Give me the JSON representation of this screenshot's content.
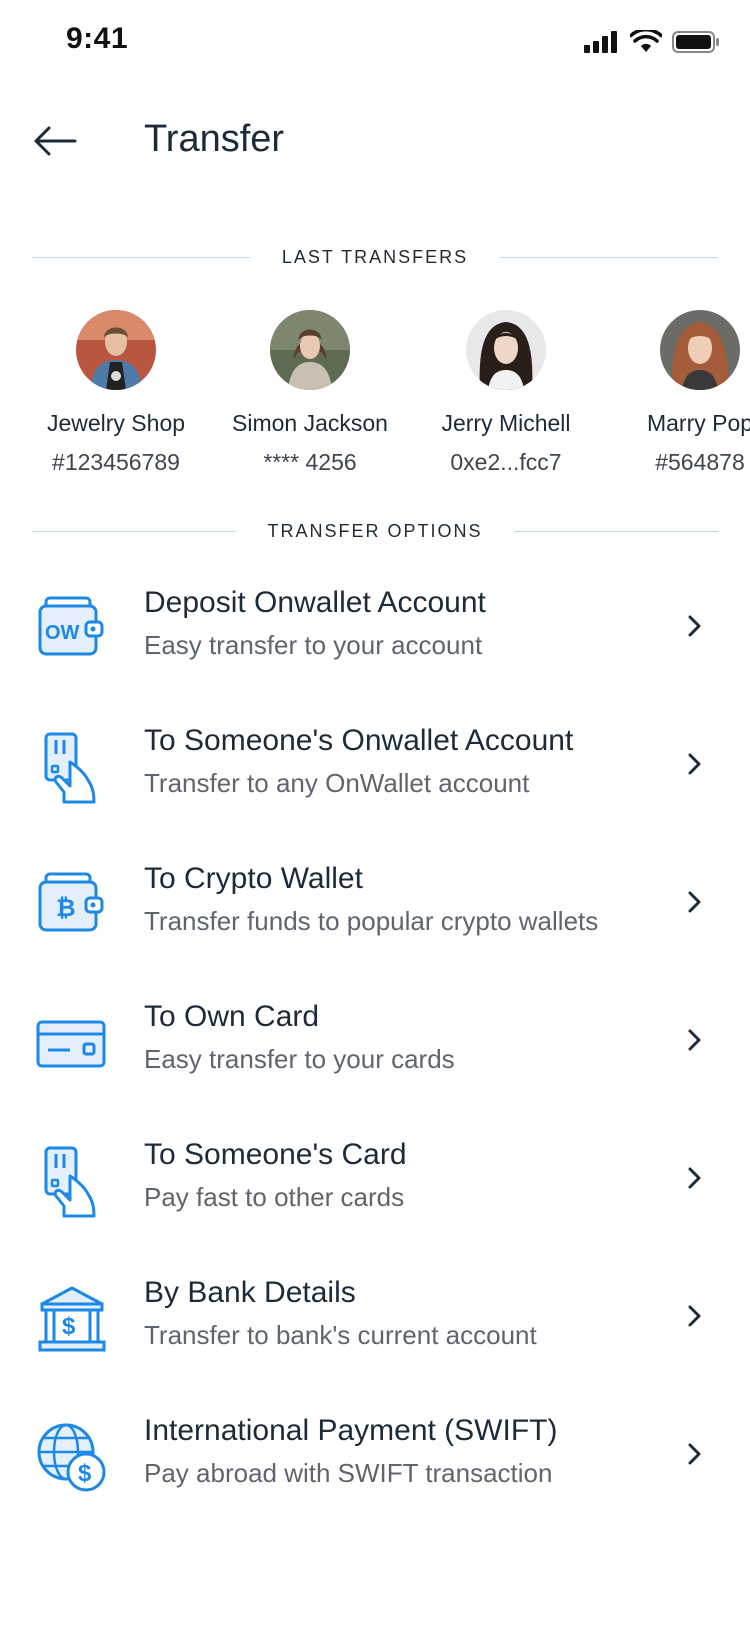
{
  "status_bar": {
    "time": "9:41"
  },
  "header": {
    "title": "Transfer"
  },
  "last_transfers": {
    "label": "LAST TRANSFERS",
    "contacts": [
      {
        "name": "Jewelry Shop",
        "account": "#123456789"
      },
      {
        "name": "Simon Jackson",
        "account": "**** 4256"
      },
      {
        "name": "Jerry Michell",
        "account": "0xe2...fcc7"
      },
      {
        "name": "Marry Pop",
        "account": "#564878"
      }
    ]
  },
  "transfer_options": {
    "label": "TRANSFER OPTIONS",
    "items": [
      {
        "icon": "wallet-ow-icon",
        "title": "Deposit Onwallet Account",
        "subtitle": "Easy transfer to your account"
      },
      {
        "icon": "hand-card-icon",
        "title": "To Someone's Onwallet Account",
        "subtitle": "Transfer to any OnWallet account"
      },
      {
        "icon": "crypto-wallet-icon",
        "title": "To Crypto Wallet",
        "subtitle": "Transfer funds to popular crypto wallets"
      },
      {
        "icon": "credit-card-icon",
        "title": "To Own Card",
        "subtitle": "Easy transfer to your cards"
      },
      {
        "icon": "hand-card-icon",
        "title": "To Someone's Card",
        "subtitle": "Pay fast to other cards"
      },
      {
        "icon": "bank-icon",
        "title": "By Bank Details",
        "subtitle": "Transfer to bank's current account"
      },
      {
        "icon": "globe-dollar-icon",
        "title": "International Payment (SWIFT)",
        "subtitle": "Pay abroad with SWIFT transaction"
      }
    ]
  },
  "colors": {
    "accent": "#1e88e5",
    "text": "#1c2b39",
    "muted": "#5d6670",
    "divider": "#b7dcf3"
  }
}
